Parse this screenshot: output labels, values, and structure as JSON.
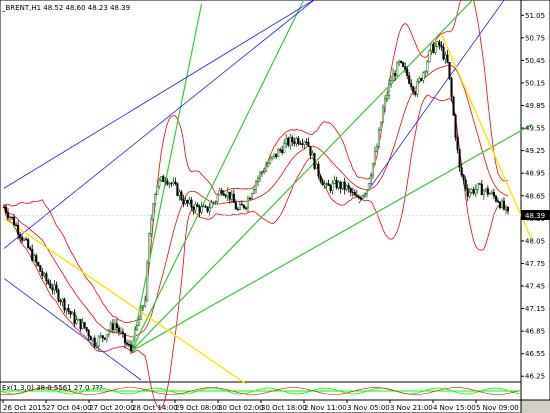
{
  "header": {
    "symbol_line": "_BRENT,H1  48.52 48.60 48.23 48.39"
  },
  "indicator": {
    "label": "Ex(1,3,0)  38.0 5561 27.0 ???"
  },
  "current_price": "48.39",
  "y_axis_labels": [
    "51.05",
    "50.75",
    "50.45",
    "50.15",
    "49.85",
    "49.55",
    "49.25",
    "48.95",
    "48.65",
    "48.35",
    "48.05",
    "47.75",
    "47.45",
    "47.15",
    "46.85",
    "46.55",
    "46.25"
  ],
  "x_axis_labels": [
    "26 Oct 2015",
    "27 Oct 04:00",
    "27 Oct 20:00",
    "28 Oct 14:00",
    "29 Oct 08:00",
    "30 Oct 02:00",
    "30 Oct 18:00",
    "2 Nov 11:00",
    "3 Nov 05:00",
    "3 Nov 21:00",
    "4 Nov 15:00",
    "5 Nov 09:00"
  ],
  "colors": {
    "background": "#ffffff",
    "frame": "#000000",
    "bull_candle": "#006400",
    "bear_candle": "#000000",
    "bollinger": "#ff0000",
    "fan_green": "#32cd32",
    "channel_blue": "#2020ff",
    "trend_yellow": "#ffe400",
    "indicator_green": "#00ff00",
    "price_tag_bg": "#000000"
  },
  "chart_data": {
    "type": "candlestick",
    "title": "_BRENT,H1",
    "ohlc": {
      "open": 48.52,
      "high": 48.6,
      "low": 48.23,
      "close": 48.39
    },
    "y_range": [
      46.2,
      51.2
    ],
    "close_path": [
      [
        0,
        48.5
      ],
      [
        5,
        48.3
      ],
      [
        10,
        48.05
      ],
      [
        15,
        47.8
      ],
      [
        20,
        47.55
      ],
      [
        25,
        47.4
      ],
      [
        30,
        47.2
      ],
      [
        35,
        47.0
      ],
      [
        40,
        46.9
      ],
      [
        45,
        46.7
      ],
      [
        50,
        46.8
      ],
      [
        55,
        46.95
      ],
      [
        60,
        46.7
      ],
      [
        63,
        46.6
      ],
      [
        66,
        46.9
      ],
      [
        70,
        47.3
      ],
      [
        72,
        48.1
      ],
      [
        74,
        48.6
      ],
      [
        76,
        48.8
      ],
      [
        80,
        48.9
      ],
      [
        85,
        48.75
      ],
      [
        90,
        48.55
      ],
      [
        95,
        48.5
      ],
      [
        100,
        48.45
      ],
      [
        105,
        48.6
      ],
      [
        108,
        48.75
      ],
      [
        112,
        48.65
      ],
      [
        116,
        48.45
      ],
      [
        120,
        48.55
      ],
      [
        125,
        48.85
      ],
      [
        130,
        49.05
      ],
      [
        135,
        49.2
      ],
      [
        140,
        49.35
      ],
      [
        145,
        49.4
      ],
      [
        150,
        49.4
      ],
      [
        155,
        49.0
      ],
      [
        160,
        48.75
      ],
      [
        165,
        48.8
      ],
      [
        170,
        48.75
      ],
      [
        175,
        48.6
      ],
      [
        180,
        48.75
      ],
      [
        185,
        49.3
      ],
      [
        188,
        49.8
      ],
      [
        192,
        50.2
      ],
      [
        196,
        50.4
      ],
      [
        200,
        50.25
      ],
      [
        204,
        50.05
      ],
      [
        208,
        50.3
      ],
      [
        212,
        50.6
      ],
      [
        216,
        50.65
      ],
      [
        220,
        50.4
      ],
      [
        222,
        49.95
      ],
      [
        226,
        49.0
      ],
      [
        230,
        48.7
      ],
      [
        235,
        48.75
      ],
      [
        240,
        48.7
      ],
      [
        245,
        48.6
      ],
      [
        250,
        48.39
      ]
    ]
  }
}
